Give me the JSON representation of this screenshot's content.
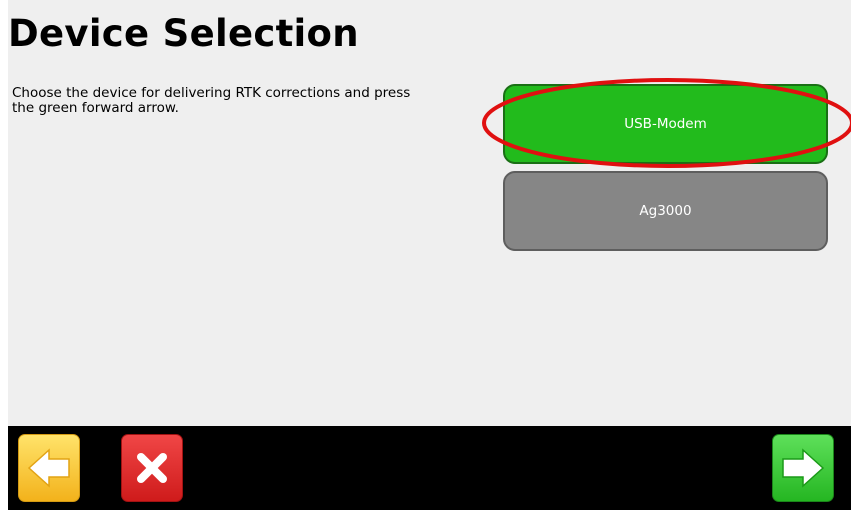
{
  "page": {
    "title": "Device Selection",
    "instructions": "Choose the device for delivering RTK corrections and press the green forward arrow."
  },
  "devices": [
    {
      "label": "USB-Modem",
      "selected": true
    },
    {
      "label": "Ag3000",
      "selected": false
    }
  ],
  "navigation": {
    "back_icon": "left-arrow-icon",
    "cancel_icon": "close-x-icon",
    "forward_icon": "right-arrow-icon"
  },
  "colors": {
    "selected_button": "#22bb1c",
    "unselected_button": "#868686",
    "highlight_ellipse": "#e01010",
    "back_button": "#f6c12e",
    "cancel_button": "#e02828",
    "forward_button": "#33c22f"
  }
}
